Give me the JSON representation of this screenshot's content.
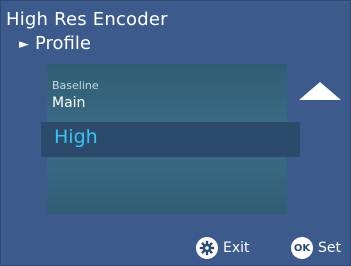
{
  "header": {
    "title": "High Res Encoder",
    "subtitle": "Profile",
    "subtitle_arrow": "►"
  },
  "options": {
    "baseline": "Baseline",
    "main": "Main",
    "selected": "High"
  },
  "footer": {
    "exit_label": "Exit",
    "set_label": "Set",
    "ok_icon_text": "OK"
  },
  "icons": {
    "scroll_up": "triangle-up-icon",
    "exit": "gear-icon",
    "set": "ok-circle-icon"
  },
  "colors": {
    "background": "#3c5b8c",
    "selected_text": "#39c3f2"
  }
}
